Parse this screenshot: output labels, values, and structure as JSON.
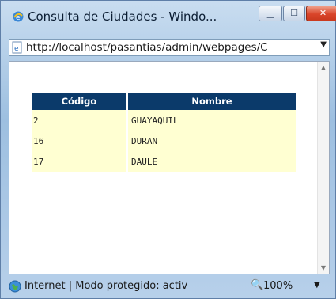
{
  "window": {
    "title": "Consulta de Ciudades - Windo..."
  },
  "address_bar": {
    "url": "http://localhost/pasantias/admin/webpages/C"
  },
  "table": {
    "headers": [
      "Código",
      "Nombre"
    ],
    "rows": [
      {
        "codigo": "2",
        "nombre": "GUAYAQUIL"
      },
      {
        "codigo": "16",
        "nombre": "DURAN"
      },
      {
        "codigo": "17",
        "nombre": "DAULE"
      }
    ]
  },
  "status_bar": {
    "zone_text": "Internet | Modo protegido: activ",
    "zoom": "100%"
  },
  "colors": {
    "header_bg": "#0b3a6a",
    "row_bg": "#ffffd2"
  }
}
